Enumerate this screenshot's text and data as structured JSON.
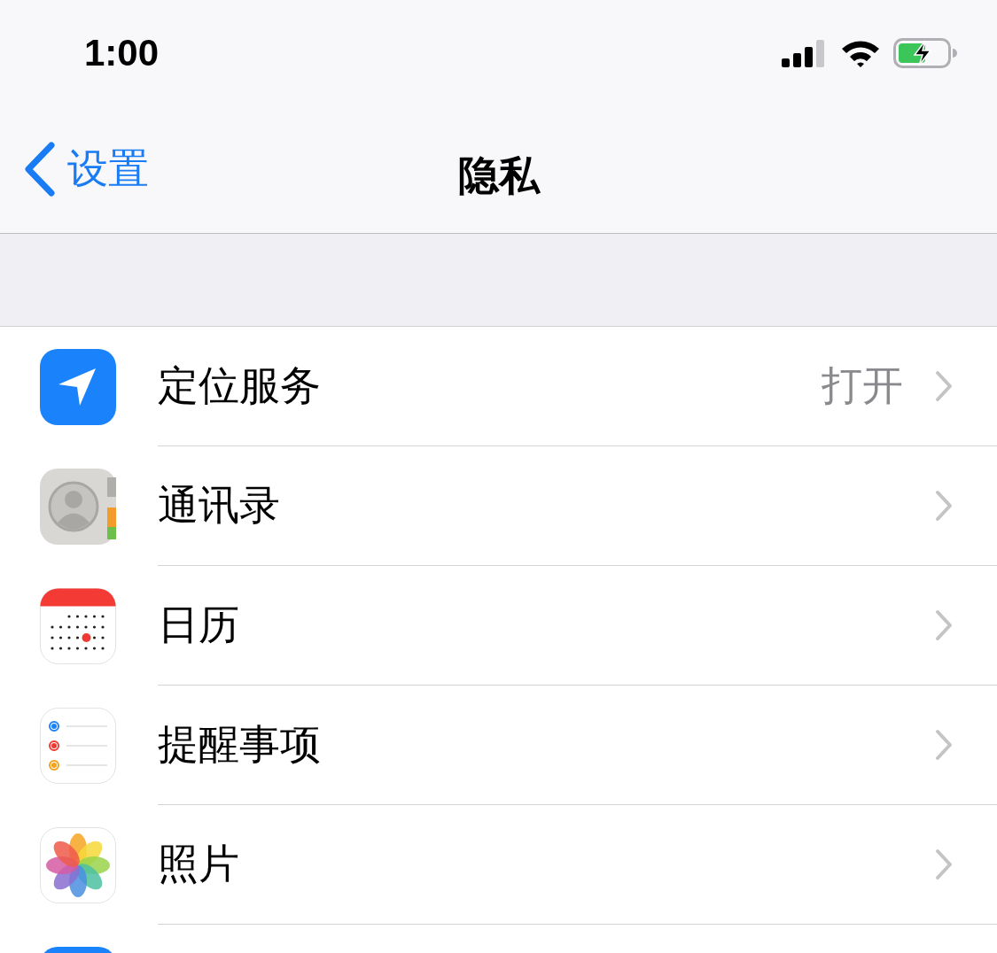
{
  "status_bar": {
    "time": "1:00"
  },
  "nav": {
    "back": "设置",
    "title": "隐私"
  },
  "rows": [
    {
      "kind": "location",
      "label": "定位服务",
      "value": "打开"
    },
    {
      "kind": "contacts",
      "label": "通讯录"
    },
    {
      "kind": "calendar",
      "label": "日历"
    },
    {
      "kind": "reminders",
      "label": "提醒事项"
    },
    {
      "kind": "photos",
      "label": "照片"
    },
    {
      "kind": "app"
    }
  ]
}
